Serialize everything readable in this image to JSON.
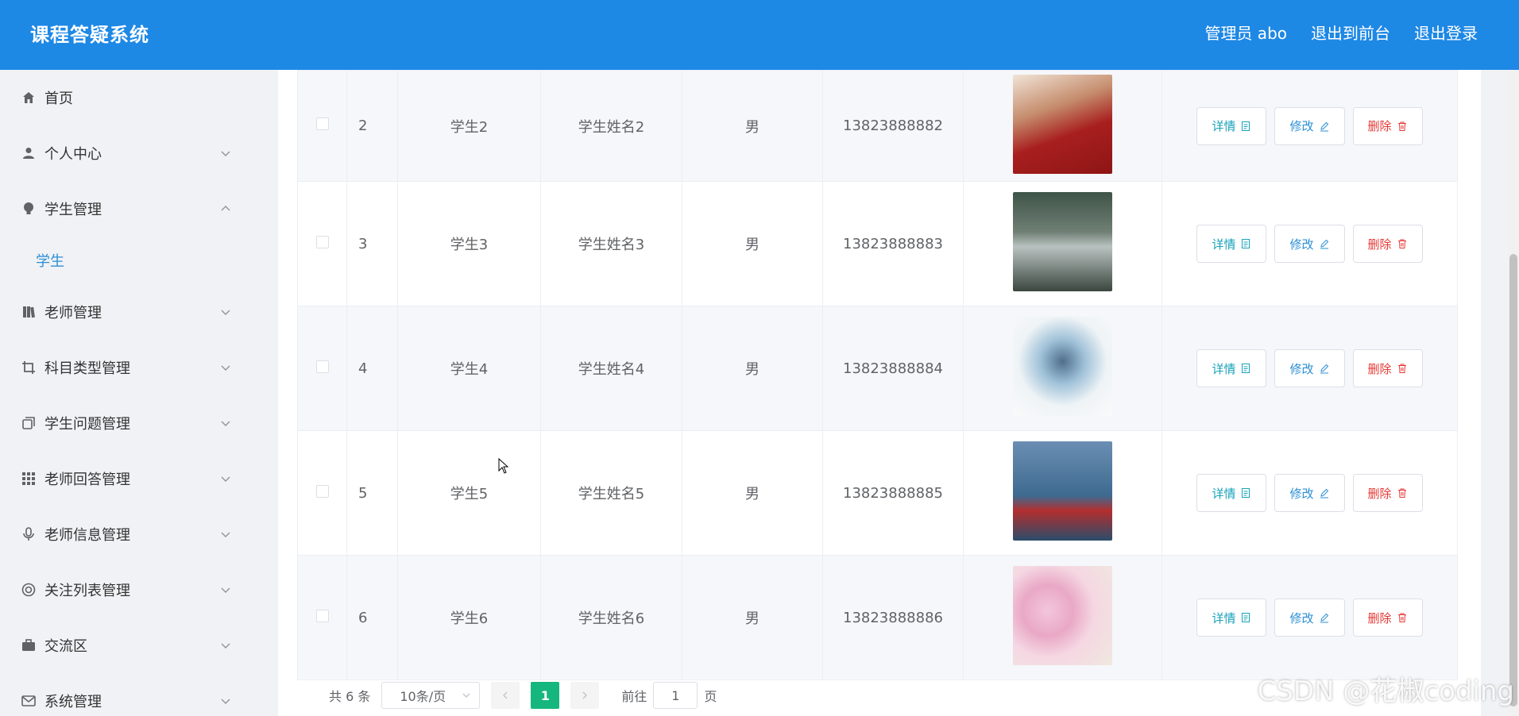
{
  "header": {
    "title": "课程答疑系统",
    "nav": [
      "管理员 abo",
      "退出到前台",
      "退出登录"
    ]
  },
  "sidebar": {
    "items": [
      {
        "label": "首页",
        "icon": "home-icon",
        "expandable": false
      },
      {
        "label": "个人中心",
        "icon": "user-icon",
        "expandable": true
      },
      {
        "label": "学生管理",
        "icon": "bulb-icon",
        "expandable": true,
        "expanded": true,
        "children": [
          "学生"
        ]
      },
      {
        "label": "老师管理",
        "icon": "books-icon",
        "expandable": true
      },
      {
        "label": "科目类型管理",
        "icon": "crop-icon",
        "expandable": true
      },
      {
        "label": "学生问题管理",
        "icon": "copy-icon",
        "expandable": true
      },
      {
        "label": "老师回答管理",
        "icon": "grid-icon",
        "expandable": true
      },
      {
        "label": "老师信息管理",
        "icon": "mic-icon",
        "expandable": true
      },
      {
        "label": "关注列表管理",
        "icon": "lifebuoy-icon",
        "expandable": true
      },
      {
        "label": "交流区",
        "icon": "briefcase-icon",
        "expandable": true
      },
      {
        "label": "系统管理",
        "icon": "mail-icon",
        "expandable": true
      }
    ]
  },
  "table": {
    "rows": [
      {
        "index": "2",
        "account": "学生2",
        "name": "学生姓名2",
        "gender": "男",
        "phone": "13823888882",
        "photo": "ph2"
      },
      {
        "index": "3",
        "account": "学生3",
        "name": "学生姓名3",
        "gender": "男",
        "phone": "13823888883",
        "photo": "ph3"
      },
      {
        "index": "4",
        "account": "学生4",
        "name": "学生姓名4",
        "gender": "男",
        "phone": "13823888884",
        "photo": "ph4"
      },
      {
        "index": "5",
        "account": "学生5",
        "name": "学生姓名5",
        "gender": "男",
        "phone": "13823888885",
        "photo": "ph5"
      },
      {
        "index": "6",
        "account": "学生6",
        "name": "学生姓名6",
        "gender": "男",
        "phone": "13823888886",
        "photo": "ph6"
      }
    ],
    "actions": {
      "detail": "详情",
      "edit": "修改",
      "delete": "删除"
    }
  },
  "pagination": {
    "total": "共 6 条",
    "page_size": "10条/页",
    "current_page": "1",
    "goto_prefix": "前往",
    "goto_value": "1",
    "goto_suffix": "页"
  },
  "watermark": "CSDN @花椒coding",
  "colors": {
    "header_bg": "#1e88e5",
    "active_submenu": "#2c8fd4",
    "detail": "#17a2b8",
    "edit": "#2c8fd4",
    "delete": "#e53935",
    "current_page_bg": "#16b77e"
  }
}
